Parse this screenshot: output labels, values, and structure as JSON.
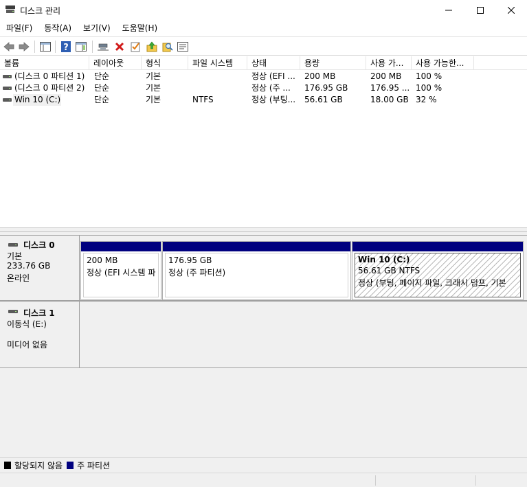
{
  "window": {
    "title": "디스크 관리",
    "minimize": "—",
    "maximize": "☐",
    "close": "✕"
  },
  "menu": {
    "items": [
      {
        "label": "파일(F)"
      },
      {
        "label": "동작(A)"
      },
      {
        "label": "보기(V)"
      },
      {
        "label": "도움말(H)"
      }
    ]
  },
  "toolbar": {
    "icons": [
      "back-icon",
      "forward-icon",
      "properties-pane-icon",
      "help-icon",
      "show-hide-pane-icon",
      "connect-icon",
      "delete-icon",
      "check-icon",
      "up-icon",
      "search-icon",
      "list-icon"
    ]
  },
  "volumes": {
    "columns": [
      "볼륨",
      "레이아웃",
      "형식",
      "파일 시스템",
      "상태",
      "용량",
      "사용 가...",
      "사용 가능한..."
    ],
    "rows": [
      {
        "name": "(디스크 0 파티션 1)",
        "layout": "단순",
        "type": "기본",
        "fs": "",
        "status": "정상 (EFI ...",
        "capacity": "200 MB",
        "free": "200 MB",
        "free_pct": "100 %"
      },
      {
        "name": "(디스크 0 파티션 2)",
        "layout": "단순",
        "type": "기본",
        "fs": "",
        "status": "정상 (주 ...",
        "capacity": "176.95 GB",
        "free": "176.95 ...",
        "free_pct": "100 %"
      },
      {
        "name": "Win 10 (C:)",
        "layout": "단순",
        "type": "기본",
        "fs": "NTFS",
        "status": "정상 (부팅...",
        "capacity": "56.61 GB",
        "free": "18.00 GB",
        "free_pct": "32 %"
      }
    ]
  },
  "disks": [
    {
      "name": "디스크 0",
      "kind": "기본",
      "size": "233.76 GB",
      "state": "온라인",
      "partitions": [
        {
          "title": "",
          "size": "200 MB",
          "status": "정상 (EFI 시스템 파"
        },
        {
          "title": "",
          "size": "176.95 GB",
          "status": "정상 (주 파티션)"
        },
        {
          "title": "Win 10  (C:)",
          "size": "56.61 GB NTFS",
          "status": "정상 (부팅, 페이지 파일, 크래시 덤프, 기본"
        }
      ]
    },
    {
      "name": "디스크 1",
      "kind": "이동식 (E:)",
      "size": "",
      "state": "미디어 없음"
    }
  ],
  "legend": {
    "items": [
      {
        "label": "할당되지 않음",
        "color": "#000000"
      },
      {
        "label": "주 파티션",
        "color": "#00007f"
      }
    ]
  },
  "colors": {
    "partition_bar": "#00007f",
    "unallocated": "#000000"
  }
}
